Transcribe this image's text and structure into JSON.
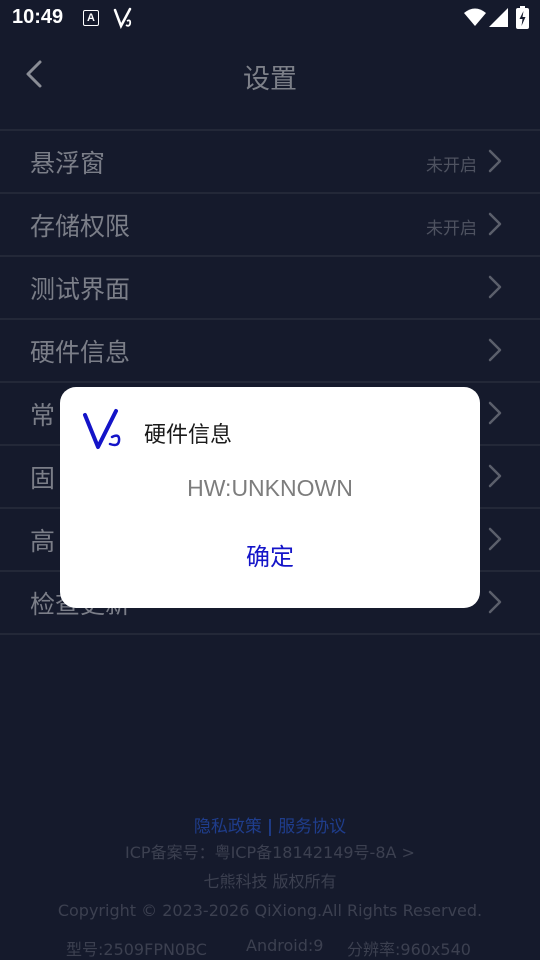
{
  "status_bar": {
    "time": "10:49",
    "notification_badge": "A",
    "icons": [
      "notification-a-icon",
      "app-logo-icon",
      "wifi-icon",
      "signal-icon",
      "battery-charging-icon"
    ]
  },
  "header": {
    "title": "设置",
    "back_icon": "chevron-left-icon"
  },
  "settings": [
    {
      "label": "悬浮窗",
      "status": "未开启"
    },
    {
      "label": "存储权限",
      "status": "未开启"
    },
    {
      "label": "测试界面",
      "status": ""
    },
    {
      "label": "硬件信息",
      "status": ""
    },
    {
      "label": "常",
      "status": ""
    },
    {
      "label": "固",
      "status": ""
    },
    {
      "label": "高",
      "status": ""
    },
    {
      "label": "检查更新",
      "status": ""
    }
  ],
  "footer": {
    "privacy_policy": "隐私政策",
    "separator": "|",
    "service_agreement": "服务协议",
    "icp": "ICP备案号：粤ICP备18142149号-8A >",
    "company": "七熊科技 版权所有",
    "copyright": "Copyright © 2023-2026 QiXiong.All Rights Reserved.",
    "model": "型号:2509FPN0BC",
    "android": "Android:9",
    "resolution": "分辨率:960x540"
  },
  "dialog": {
    "logo_icon": "app-logo-icon",
    "title": "硬件信息",
    "message": "HW:UNKNOWN",
    "confirm_label": "确定"
  },
  "colors": {
    "background": "#151a2c",
    "divider": "#232838",
    "dialog_bg": "#ffffff",
    "accent": "#1414c8",
    "footer_link": "#1f3d8c"
  }
}
